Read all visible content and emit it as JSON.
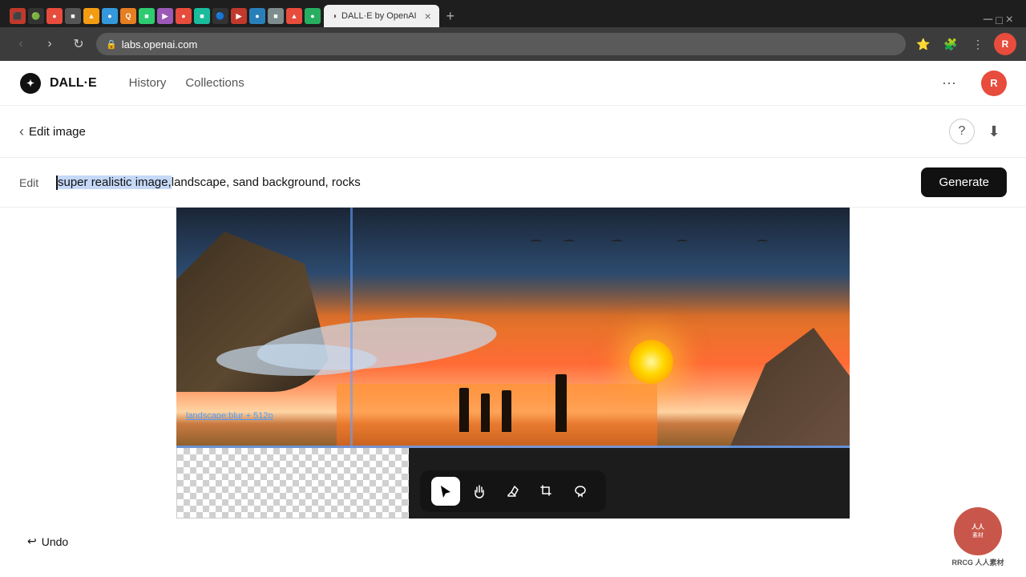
{
  "browser": {
    "tabs": [
      {
        "label": "DALL·E by OpenAI",
        "active": true
      },
      {
        "label": "New Tab",
        "active": false
      }
    ],
    "address": "labs.openai.com",
    "favicons": [
      "⬛",
      "🟢",
      "🔴",
      "⬛",
      "🟡",
      "🔵",
      "🟠",
      "⬛",
      "🔵",
      "🟢",
      "🟠",
      "⬛",
      "🟤",
      "⬛",
      "🟣",
      "🟡",
      "🔴",
      "⬛",
      "🟢",
      "🔵",
      "⬛",
      "🟠",
      "⬛",
      "⬛",
      "🟡",
      "⬛",
      "⬛",
      "⬛",
      "⬛",
      "🔴",
      "⬛"
    ]
  },
  "nav": {
    "app_name": "DALL·E",
    "history_label": "History",
    "collections_label": "Collections",
    "more_icon": "···",
    "profile_initial": "R"
  },
  "edit_header": {
    "back_label": "Edit image",
    "help_icon": "?",
    "download_icon": "⬇"
  },
  "prompt_bar": {
    "edit_label": "Edit",
    "prompt_highlighted": "super realistic image,",
    "prompt_normal": " landscape, sand background, rocks",
    "generate_label": "Generate"
  },
  "image": {
    "overlay_text": "landscape:blur + 512p",
    "alt": "Sunset beach landscape with silhouettes"
  },
  "toolbar": {
    "tools": [
      {
        "name": "select",
        "icon": "↖",
        "active": true
      },
      {
        "name": "hand",
        "icon": "✋",
        "active": false
      },
      {
        "name": "eraser",
        "icon": "◇",
        "active": false
      },
      {
        "name": "crop",
        "icon": "⊡",
        "active": false
      },
      {
        "name": "lasso",
        "icon": "⌇",
        "active": false
      }
    ]
  },
  "undo": {
    "label": "Undo",
    "icon": "↩"
  },
  "watermark": {
    "text": "RRCG\n人人素材"
  }
}
